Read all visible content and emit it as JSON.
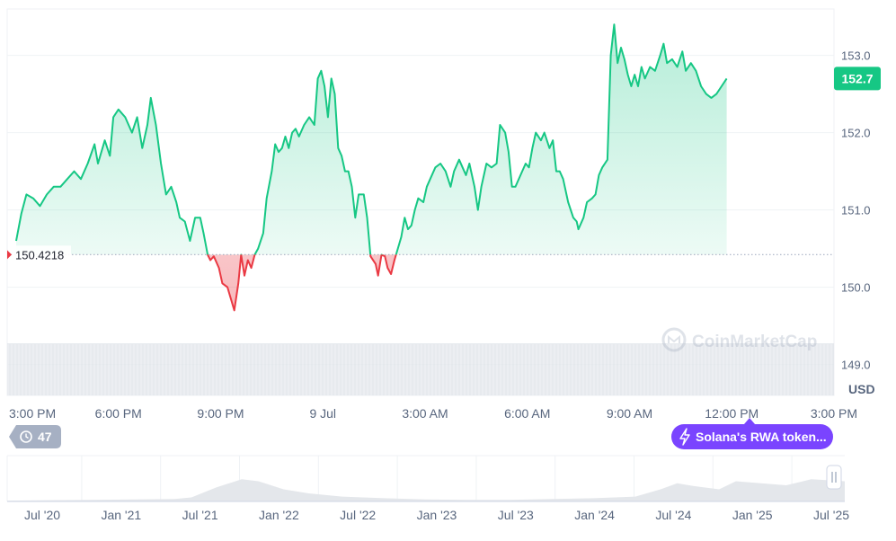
{
  "chart_data": {
    "type": "line",
    "title": "",
    "currency": "USD",
    "baseline": 150.4218,
    "baseline_label": "150.4218",
    "current_value": 152.7,
    "current_label": "152.7",
    "ylim": [
      148.6,
      153.6
    ],
    "y_ticks": [
      {
        "value": 149.0,
        "label": "149.0"
      },
      {
        "value": 150.0,
        "label": "150.0"
      },
      {
        "value": 151.0,
        "label": "151.0"
      },
      {
        "value": 152.0,
        "label": "152.0"
      },
      {
        "value": 153.0,
        "label": "153.0"
      }
    ],
    "x_ticks": [
      {
        "t": 0,
        "label": "3:00 PM"
      },
      {
        "t": 3,
        "label": "6:00 PM"
      },
      {
        "t": 6,
        "label": "9:00 PM"
      },
      {
        "t": 9,
        "label": "9 Jul"
      },
      {
        "t": 12,
        "label": "3:00 AM"
      },
      {
        "t": 15,
        "label": "6:00 AM"
      },
      {
        "t": 18,
        "label": "9:00 AM"
      },
      {
        "t": 21,
        "label": "12:00 PM"
      },
      {
        "t": 24,
        "label": "3:00 PM"
      }
    ],
    "series": [
      {
        "values": [
          [
            0.0,
            150.6
          ],
          [
            0.15,
            150.95
          ],
          [
            0.3,
            151.2
          ],
          [
            0.5,
            151.15
          ],
          [
            0.7,
            151.05
          ],
          [
            0.9,
            151.2
          ],
          [
            1.1,
            151.3
          ],
          [
            1.3,
            151.3
          ],
          [
            1.5,
            151.4
          ],
          [
            1.7,
            151.5
          ],
          [
            1.9,
            151.4
          ],
          [
            2.1,
            151.6
          ],
          [
            2.3,
            151.85
          ],
          [
            2.4,
            151.6
          ],
          [
            2.6,
            151.9
          ],
          [
            2.75,
            151.7
          ],
          [
            2.85,
            152.2
          ],
          [
            3.0,
            152.3
          ],
          [
            3.2,
            152.2
          ],
          [
            3.4,
            152.0
          ],
          [
            3.55,
            152.2
          ],
          [
            3.7,
            151.8
          ],
          [
            3.85,
            152.1
          ],
          [
            3.95,
            152.45
          ],
          [
            4.1,
            152.1
          ],
          [
            4.25,
            151.6
          ],
          [
            4.4,
            151.2
          ],
          [
            4.55,
            151.3
          ],
          [
            4.7,
            151.1
          ],
          [
            4.8,
            150.9
          ],
          [
            4.95,
            150.85
          ],
          [
            5.1,
            150.6
          ],
          [
            5.25,
            150.9
          ],
          [
            5.4,
            150.9
          ],
          [
            5.5,
            150.7
          ],
          [
            5.62,
            150.42
          ],
          [
            5.7,
            150.35
          ],
          [
            5.8,
            150.4
          ],
          [
            5.95,
            150.25
          ],
          [
            6.05,
            150.05
          ],
          [
            6.2,
            150.0
          ],
          [
            6.3,
            149.85
          ],
          [
            6.4,
            149.7
          ],
          [
            6.52,
            150.05
          ],
          [
            6.6,
            150.42
          ],
          [
            6.7,
            150.15
          ],
          [
            6.8,
            150.35
          ],
          [
            6.9,
            150.25
          ],
          [
            7.0,
            150.42
          ],
          [
            7.1,
            150.5
          ],
          [
            7.25,
            150.7
          ],
          [
            7.35,
            151.15
          ],
          [
            7.5,
            151.5
          ],
          [
            7.6,
            151.85
          ],
          [
            7.7,
            151.75
          ],
          [
            7.8,
            151.8
          ],
          [
            7.9,
            151.95
          ],
          [
            8.0,
            151.8
          ],
          [
            8.1,
            152.0
          ],
          [
            8.2,
            152.05
          ],
          [
            8.3,
            151.95
          ],
          [
            8.45,
            152.1
          ],
          [
            8.6,
            152.2
          ],
          [
            8.75,
            152.1
          ],
          [
            8.85,
            152.7
          ],
          [
            8.95,
            152.8
          ],
          [
            9.05,
            152.6
          ],
          [
            9.15,
            152.2
          ],
          [
            9.25,
            152.7
          ],
          [
            9.35,
            152.5
          ],
          [
            9.45,
            151.8
          ],
          [
            9.55,
            151.7
          ],
          [
            9.65,
            151.5
          ],
          [
            9.75,
            151.5
          ],
          [
            9.85,
            151.3
          ],
          [
            9.95,
            150.9
          ],
          [
            10.05,
            151.2
          ],
          [
            10.2,
            151.2
          ],
          [
            10.3,
            150.9
          ],
          [
            10.4,
            150.4
          ],
          [
            10.55,
            150.3
          ],
          [
            10.62,
            150.15
          ],
          [
            10.72,
            150.42
          ],
          [
            10.82,
            150.4
          ],
          [
            10.9,
            150.25
          ],
          [
            11.0,
            150.17
          ],
          [
            11.1,
            150.35
          ],
          [
            11.2,
            150.5
          ],
          [
            11.3,
            150.65
          ],
          [
            11.4,
            150.9
          ],
          [
            11.5,
            150.75
          ],
          [
            11.6,
            150.8
          ],
          [
            11.7,
            151.0
          ],
          [
            11.8,
            151.15
          ],
          [
            11.95,
            151.1
          ],
          [
            12.05,
            151.3
          ],
          [
            12.15,
            151.4
          ],
          [
            12.3,
            151.55
          ],
          [
            12.45,
            151.6
          ],
          [
            12.6,
            151.5
          ],
          [
            12.75,
            151.3
          ],
          [
            12.85,
            151.5
          ],
          [
            13.0,
            151.65
          ],
          [
            13.1,
            151.55
          ],
          [
            13.2,
            151.45
          ],
          [
            13.3,
            151.6
          ],
          [
            13.45,
            151.3
          ],
          [
            13.55,
            151.0
          ],
          [
            13.65,
            151.3
          ],
          [
            13.8,
            151.6
          ],
          [
            13.95,
            151.55
          ],
          [
            14.1,
            151.6
          ],
          [
            14.2,
            152.1
          ],
          [
            14.35,
            152.0
          ],
          [
            14.45,
            151.75
          ],
          [
            14.55,
            151.3
          ],
          [
            14.65,
            151.3
          ],
          [
            14.8,
            151.45
          ],
          [
            14.95,
            151.6
          ],
          [
            15.05,
            151.55
          ],
          [
            15.15,
            151.8
          ],
          [
            15.25,
            152.0
          ],
          [
            15.4,
            151.9
          ],
          [
            15.5,
            152.0
          ],
          [
            15.65,
            151.8
          ],
          [
            15.75,
            151.9
          ],
          [
            15.85,
            151.5
          ],
          [
            15.95,
            151.5
          ],
          [
            16.05,
            151.4
          ],
          [
            16.2,
            151.1
          ],
          [
            16.35,
            150.9
          ],
          [
            16.45,
            150.85
          ],
          [
            16.5,
            150.75
          ],
          [
            16.65,
            150.9
          ],
          [
            16.75,
            151.1
          ],
          [
            16.9,
            151.15
          ],
          [
            17.0,
            151.2
          ],
          [
            17.1,
            151.45
          ],
          [
            17.2,
            151.55
          ],
          [
            17.35,
            151.65
          ],
          [
            17.45,
            153.0
          ],
          [
            17.55,
            153.4
          ],
          [
            17.65,
            152.9
          ],
          [
            17.75,
            153.1
          ],
          [
            17.85,
            152.95
          ],
          [
            17.95,
            152.75
          ],
          [
            18.05,
            152.6
          ],
          [
            18.15,
            152.75
          ],
          [
            18.25,
            152.6
          ],
          [
            18.35,
            152.85
          ],
          [
            18.45,
            152.7
          ],
          [
            18.6,
            152.85
          ],
          [
            18.75,
            152.8
          ],
          [
            18.9,
            153.0
          ],
          [
            19.0,
            153.15
          ],
          [
            19.1,
            152.9
          ],
          [
            19.25,
            152.95
          ],
          [
            19.4,
            152.85
          ],
          [
            19.55,
            153.05
          ],
          [
            19.65,
            152.8
          ],
          [
            19.8,
            152.9
          ],
          [
            19.95,
            152.8
          ],
          [
            20.1,
            152.6
          ],
          [
            20.25,
            152.5
          ],
          [
            20.4,
            152.45
          ],
          [
            20.55,
            152.5
          ],
          [
            20.7,
            152.6
          ],
          [
            20.85,
            152.7
          ]
        ]
      }
    ],
    "volume": {
      "label": "",
      "level": 0.85
    },
    "timeline": {
      "years": [
        "Jul '20",
        "Jan '21",
        "Jul '21",
        "Jan '22",
        "Jul '22",
        "Jan '23",
        "Jul '23",
        "Jan '24",
        "Jul '24",
        "Jan '25",
        "Jul '25"
      ],
      "history": [
        [
          0,
          0.02
        ],
        [
          5,
          0.03
        ],
        [
          10,
          0.04
        ],
        [
          15,
          0.05
        ],
        [
          20,
          0.06
        ],
        [
          22,
          0.1
        ],
        [
          25,
          0.35
        ],
        [
          28,
          0.55
        ],
        [
          30,
          0.5
        ],
        [
          33,
          0.3
        ],
        [
          36,
          0.2
        ],
        [
          40,
          0.12
        ],
        [
          45,
          0.08
        ],
        [
          50,
          0.05
        ],
        [
          55,
          0.04
        ],
        [
          60,
          0.04
        ],
        [
          65,
          0.06
        ],
        [
          70,
          0.08
        ],
        [
          75,
          0.12
        ],
        [
          78,
          0.3
        ],
        [
          80,
          0.45
        ],
        [
          82,
          0.38
        ],
        [
          85,
          0.3
        ],
        [
          87,
          0.5
        ],
        [
          90,
          0.45
        ],
        [
          93,
          0.4
        ],
        [
          96,
          0.55
        ],
        [
          100,
          0.5
        ]
      ]
    },
    "badges": {
      "history_count": "47",
      "news_label": "Solana's RWA token..."
    },
    "watermark": "CoinMarketCap",
    "colors": {
      "up": "#16c784",
      "down": "#ea3943",
      "grid": "#eff2f5",
      "axis_text": "#58667e",
      "tag_gray": "#a6b0c3",
      "news_purple": "#7a44ff"
    }
  }
}
